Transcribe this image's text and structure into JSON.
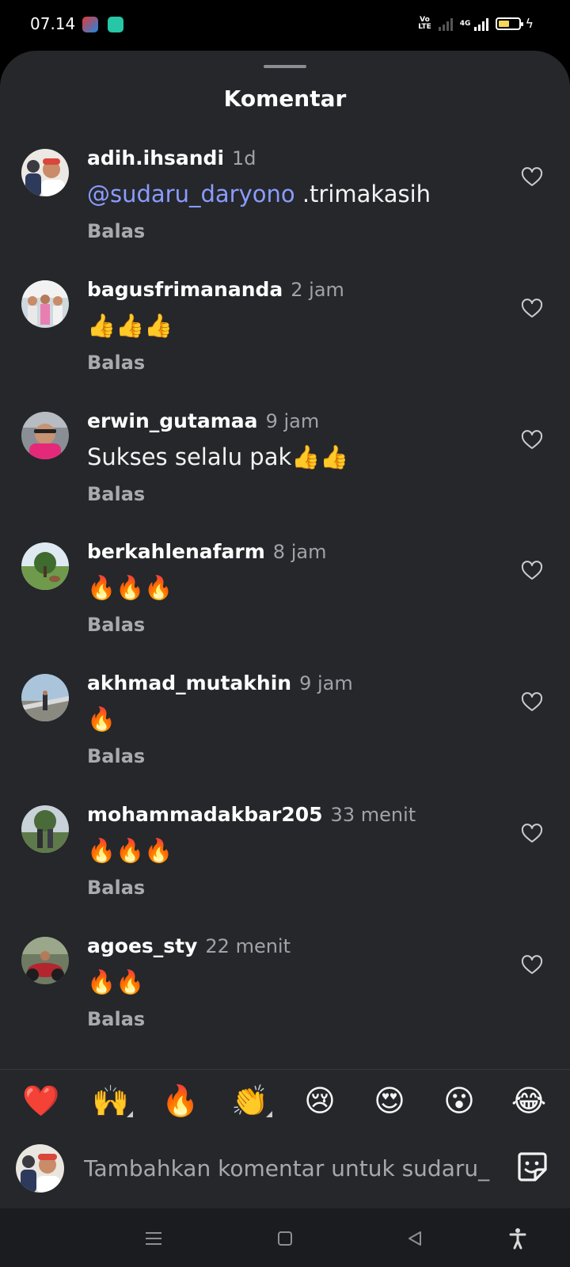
{
  "status_bar": {
    "time": "07.14",
    "network_label": "4G",
    "volte_label": "Vo\nLTE"
  },
  "sheet": {
    "title": "Komentar"
  },
  "comments": [
    {
      "username": "adih.ihsandi",
      "time": "1d",
      "mention": "@sudaru_daryono",
      "text": " .trimakasih",
      "reply": "Balas"
    },
    {
      "username": "bagusfrimananda",
      "time": "2 jam",
      "mention": "",
      "text": "👍👍👍",
      "reply": "Balas"
    },
    {
      "username": "erwin_gutamaa",
      "time": "9 jam",
      "mention": "",
      "text": "Sukses selalu pak👍👍",
      "reply": "Balas"
    },
    {
      "username": "berkahlenafarm",
      "time": "8 jam",
      "mention": "",
      "text": "🔥🔥🔥",
      "reply": "Balas"
    },
    {
      "username": "akhmad_mutakhin",
      "time": "9 jam",
      "mention": "",
      "text": "🔥",
      "reply": "Balas"
    },
    {
      "username": "mohammadakbar205",
      "time": "33 menit",
      "mention": "",
      "text": "🔥🔥🔥",
      "reply": "Balas"
    },
    {
      "username": "agoes_sty",
      "time": "22 menit",
      "mention": "",
      "text": "🔥🔥",
      "reply": "Balas"
    }
  ],
  "reactions": [
    "❤️",
    "🙌",
    "🔥",
    "👏",
    "😢",
    "😍",
    "😮",
    "😂"
  ],
  "compose": {
    "placeholder": "Tambahkan komentar untuk sudaru_"
  },
  "icons": {
    "like": "heart-outline-icon",
    "sticker": "sticker-icon",
    "nav": [
      "menu-icon",
      "home-square-icon",
      "back-triangle-icon",
      "accessibility-icon"
    ]
  },
  "colors": {
    "background": "#25272b",
    "mention": "#8a9cff",
    "battery": "#f6d55c"
  }
}
